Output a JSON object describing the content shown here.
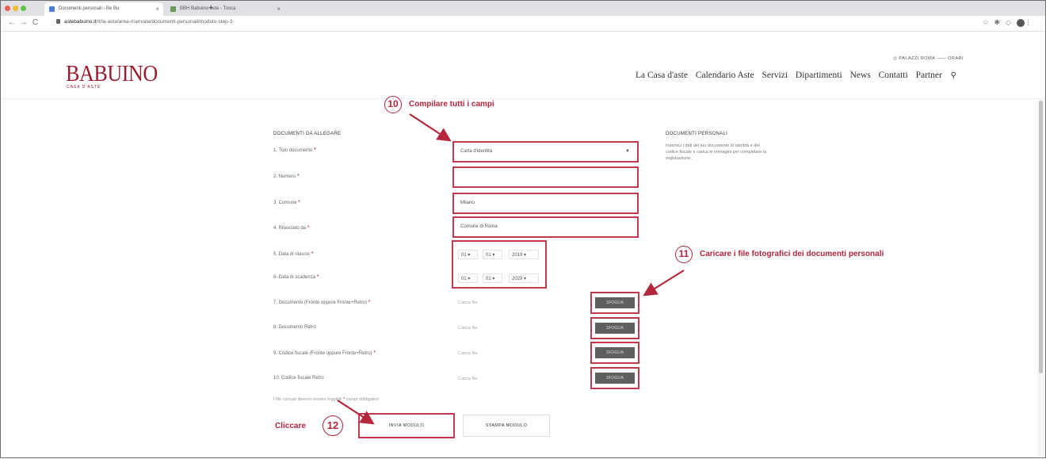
{
  "browser": {
    "tabs": [
      {
        "title": "Documenti personali - Be Bu",
        "active": true,
        "favicon_color": "#4a7fd6"
      },
      {
        "title": "BBH Babuino Aste - Tosca",
        "active": false,
        "favicon_color": "#6a9a5a"
      }
    ],
    "url_domain": "astebabuino.it",
    "url_path": "/it/la-asta/area-riservata/documenti-personali/modulo-step-3",
    "new_tab": "+",
    "nav": {
      "back": "←",
      "forward": "→",
      "reload": "C"
    },
    "icons": [
      "star-icon",
      "extension-icon",
      "menu-icon"
    ]
  },
  "site": {
    "logo": "BABUINO",
    "logo_sub": "CASA D'ASTE",
    "top_links": "◎ PALAZZI ROMA  ——  ORARI",
    "nav": [
      "La Casa d'aste",
      "Calendario Aste",
      "Servizi",
      "Dipartimenti",
      "News",
      "Contatti",
      "Partner"
    ],
    "search_icon": "⚲",
    "accent": "#9a1c2e"
  },
  "form": {
    "section_title": "DOCUMENTI DA ALLEGARE",
    "required_mark": "*",
    "fields": [
      {
        "label": "1. Tipo documento",
        "required": true,
        "value": "Carta d'identità",
        "kind": "select"
      },
      {
        "label": "2. Numero",
        "required": true,
        "value": "",
        "kind": "text"
      },
      {
        "label": "3. Comune",
        "required": true,
        "value": "Milano",
        "kind": "text"
      },
      {
        "label": "4. Rilasciato da",
        "required": true,
        "value": "Comune di Roma",
        "kind": "text"
      }
    ],
    "dates": [
      {
        "label": "5. Data di rilascio",
        "required": true,
        "day": "01",
        "month": "01",
        "year": "2019"
      },
      {
        "label": "6. Data di scadenza",
        "required": true,
        "day": "01",
        "month": "01",
        "year": "2029"
      }
    ],
    "files": [
      {
        "label": "7. Documento (Fronte oppure Fronte+Retro)",
        "required": true,
        "placeholder": "Carica file",
        "button": "SFOGLIA"
      },
      {
        "label": "8. Documento Retro",
        "required": false,
        "placeholder": "Carica file",
        "button": "SFOGLIA"
      },
      {
        "label": "9. Codice fiscale (Fronte oppure Fronte+Retro)",
        "required": true,
        "placeholder": "Carica file",
        "button": "SFOGLIA"
      },
      {
        "label": "10. Codice fiscale Retro",
        "required": false,
        "placeholder": "Carica file",
        "button": "SFOGLIA"
      }
    ],
    "note_text": "I file caricati devono essere leggibili",
    "note_suffix": "campi obbligatori",
    "send_button": "INVIA MODULO",
    "print_button": "STAMPA MODULO"
  },
  "aside": {
    "title": "DOCUMENTI PERSONALI",
    "text": "Inserisci i dati del tuo documento di identità e del codice fiscale e carica le immagini per completare la registrazione."
  },
  "annotations": {
    "step10_number": "10",
    "step10_text": "Compilare tutti i campi",
    "step11_number": "11",
    "step11_text": "Caricare i file fotografici dei documenti personali",
    "step12_number": "12",
    "step12_text": "Cliccare",
    "color": "#b3263b"
  }
}
